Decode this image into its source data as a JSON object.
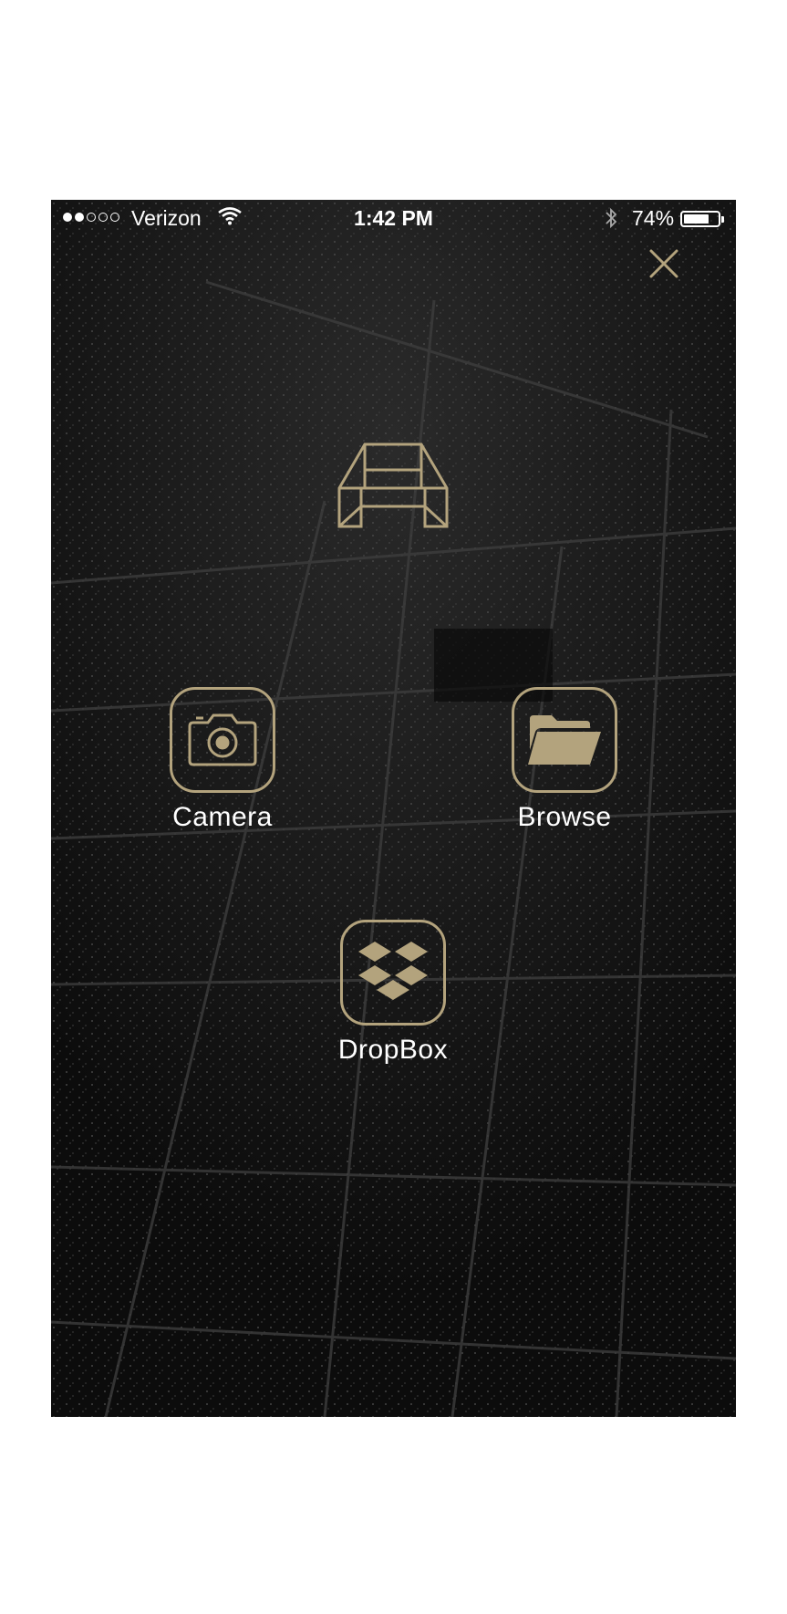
{
  "status_bar": {
    "signal_bars_filled": 2,
    "signal_bars_total": 5,
    "carrier": "Verizon",
    "time": "1:42 PM",
    "battery_percent": "74%",
    "battery_level": 0.74
  },
  "header": {
    "close_icon": "close-icon"
  },
  "logo": {
    "icon": "app-logo-icon"
  },
  "actions": {
    "camera": {
      "label": "Camera",
      "icon": "camera-icon"
    },
    "browse": {
      "label": "Browse",
      "icon": "folder-icon"
    },
    "dropbox": {
      "label": "DropBox",
      "icon": "dropbox-icon"
    }
  },
  "colors": {
    "accent_gold": "#b3a37d",
    "background": "#101010",
    "text": "#ffffff"
  }
}
